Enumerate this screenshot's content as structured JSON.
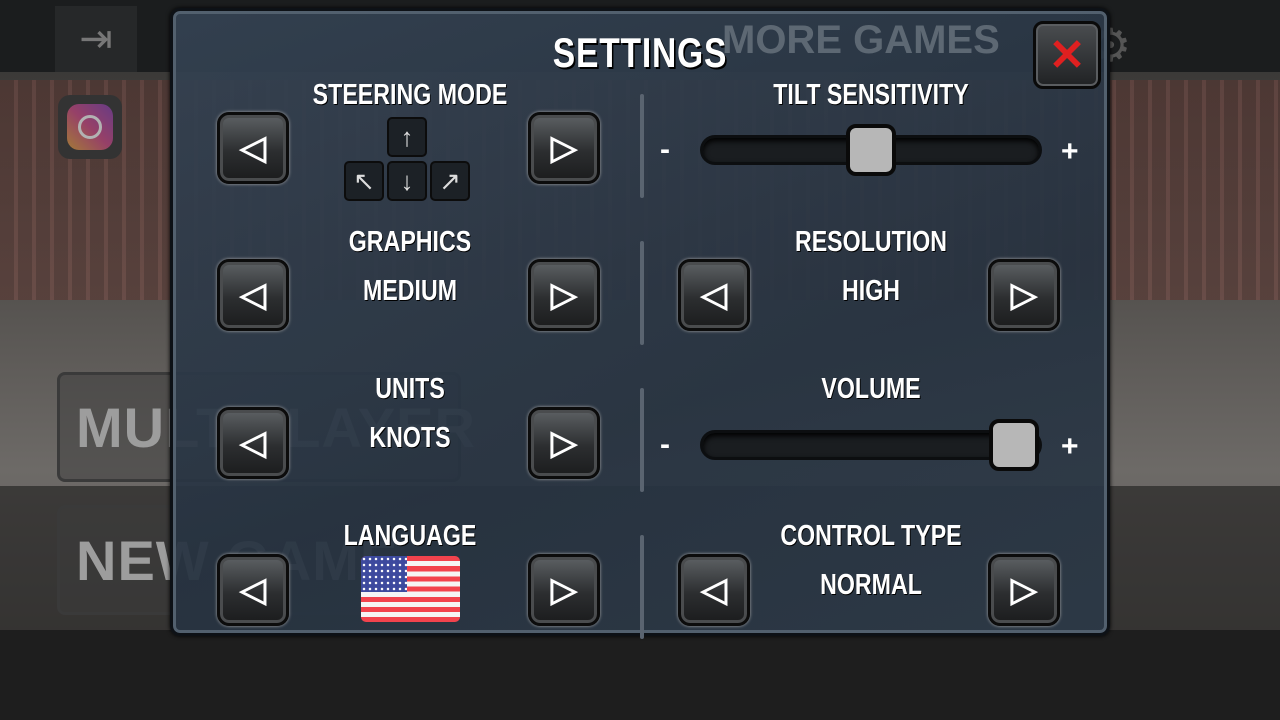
{
  "background": {
    "more_games": "MORE GAMES",
    "multiplayer": "MULTIPLAYER",
    "new_game": "NEW GAME",
    "icons": [
      "exit-icon",
      "instagram-icon",
      "gear-icon"
    ]
  },
  "settings": {
    "title": "SETTINGS",
    "close_icon": "✕",
    "steering_mode": {
      "label": "STEERING MODE",
      "icons": [
        "arrow-up",
        "arrow-up-left",
        "arrow-down",
        "arrow-up-right"
      ]
    },
    "tilt_sensitivity": {
      "label": "TILT SENSITIVITY",
      "minus": "-",
      "plus": "+",
      "value_percent": 50
    },
    "graphics": {
      "label": "GRAPHICS",
      "value": "MEDIUM"
    },
    "resolution": {
      "label": "RESOLUTION",
      "value": "HIGH"
    },
    "units": {
      "label": "UNITS",
      "value": "KNOTS"
    },
    "volume": {
      "label": "VOLUME",
      "minus": "-",
      "plus": "+",
      "value_percent": 100
    },
    "language": {
      "label": "LANGUAGE",
      "value_icon": "us-flag"
    },
    "control_type": {
      "label": "CONTROL TYPE",
      "value": "NORMAL"
    },
    "arrow_left": "◁",
    "arrow_right": "▷"
  },
  "colors": {
    "close": "#e02020",
    "panel": "#2e3c4c"
  }
}
